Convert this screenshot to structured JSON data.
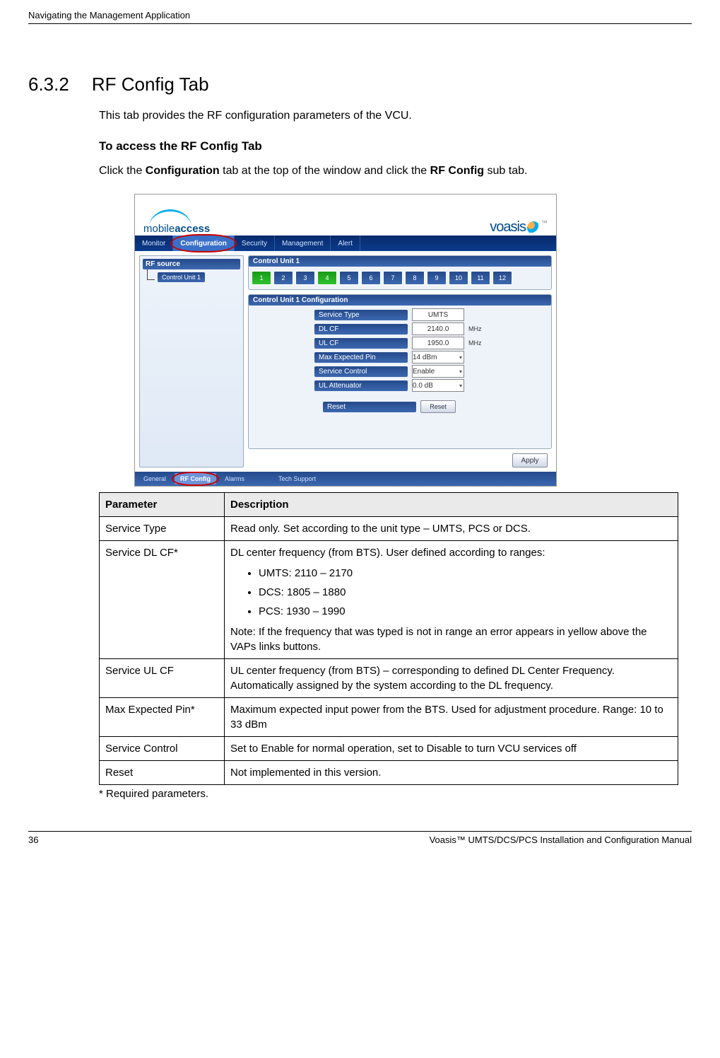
{
  "header": {
    "running": "Navigating the Management Application"
  },
  "section": {
    "number": "6.3.2",
    "title": "RF Config Tab",
    "intro": "This tab provides the RF configuration parameters of the VCU.",
    "access_heading": "To access the RF Config Tab",
    "access_pre": "Click the ",
    "access_b1": "Configuration",
    "access_mid": " tab at the top of the window and click the ",
    "access_b2": "RF Config",
    "access_post": " sub tab."
  },
  "screenshot": {
    "logo_ma_1": "mobile",
    "logo_ma_2": "access",
    "logo_voasis": "voasis",
    "tm": "™",
    "tabs": {
      "monitor": "Monitor",
      "configuration": "Configuration",
      "security": "Security",
      "management": "Management",
      "alert": "Alert"
    },
    "sidebar": {
      "title": "RF source",
      "node": "Control Unit 1"
    },
    "panel_cu": {
      "title": "Control Unit 1",
      "vaps": [
        "1",
        "2",
        "3",
        "4",
        "5",
        "6",
        "7",
        "8",
        "9",
        "10",
        "11",
        "12"
      ]
    },
    "panel_cfg": {
      "title": "Control Unit 1 Configuration",
      "rows": {
        "service_type": {
          "label": "Service Type",
          "value": "UMTS"
        },
        "dl_cf": {
          "label": "DL CF",
          "value": "2140.0",
          "unit": "MHz"
        },
        "ul_cf": {
          "label": "UL CF",
          "value": "1950.0",
          "unit": "MHz"
        },
        "max_pin": {
          "label": "Max Expected Pin",
          "value": "14 dBm"
        },
        "svc_ctrl": {
          "label": "Service Control",
          "value": "Enable"
        },
        "ul_att": {
          "label": "UL Attenuator",
          "value": "0.0 dB"
        },
        "reset": {
          "label": "Reset",
          "button": "Reset"
        }
      },
      "apply": "Apply"
    },
    "subtabs": {
      "general": "General",
      "rfconfig": "RF Config",
      "alarms": "Alarms",
      "techsupport": "Tech Support"
    }
  },
  "table": {
    "h1": "Parameter",
    "h2": "Description",
    "rows": [
      {
        "p": "Service Type",
        "d": "Read only. Set according to the unit type – UMTS, PCS or DCS."
      },
      {
        "p": "Service DL CF*",
        "d_pre": "DL center frequency (from BTS). User defined according to ranges:",
        "b": [
          "UMTS:  2110 – 2170",
          "DCS:     1805 – 1880",
          "PCS:     1930 – 1990"
        ],
        "d_post": "Note: If the frequency that was typed is not in range an error appears in yellow above the VAPs links buttons."
      },
      {
        "p": "Service UL CF",
        "d": "UL center frequency (from BTS) – corresponding to defined DL Center Frequency. Automatically assigned by the system according to the DL frequency."
      },
      {
        "p": "Max Expected Pin*",
        "d": "Maximum expected input power from the BTS. Used for adjustment procedure. Range: 10 to 33 dBm"
      },
      {
        "p": "Service Control",
        "d": "Set to Enable for normal operation, set to Disable to turn VCU services off"
      },
      {
        "p": "Reset",
        "d": "Not implemented in this version."
      }
    ]
  },
  "req_note": "* Required parameters.",
  "footer": {
    "page": "36",
    "title": "Voasis™ UMTS/DCS/PCS Installation and Configuration Manual"
  }
}
